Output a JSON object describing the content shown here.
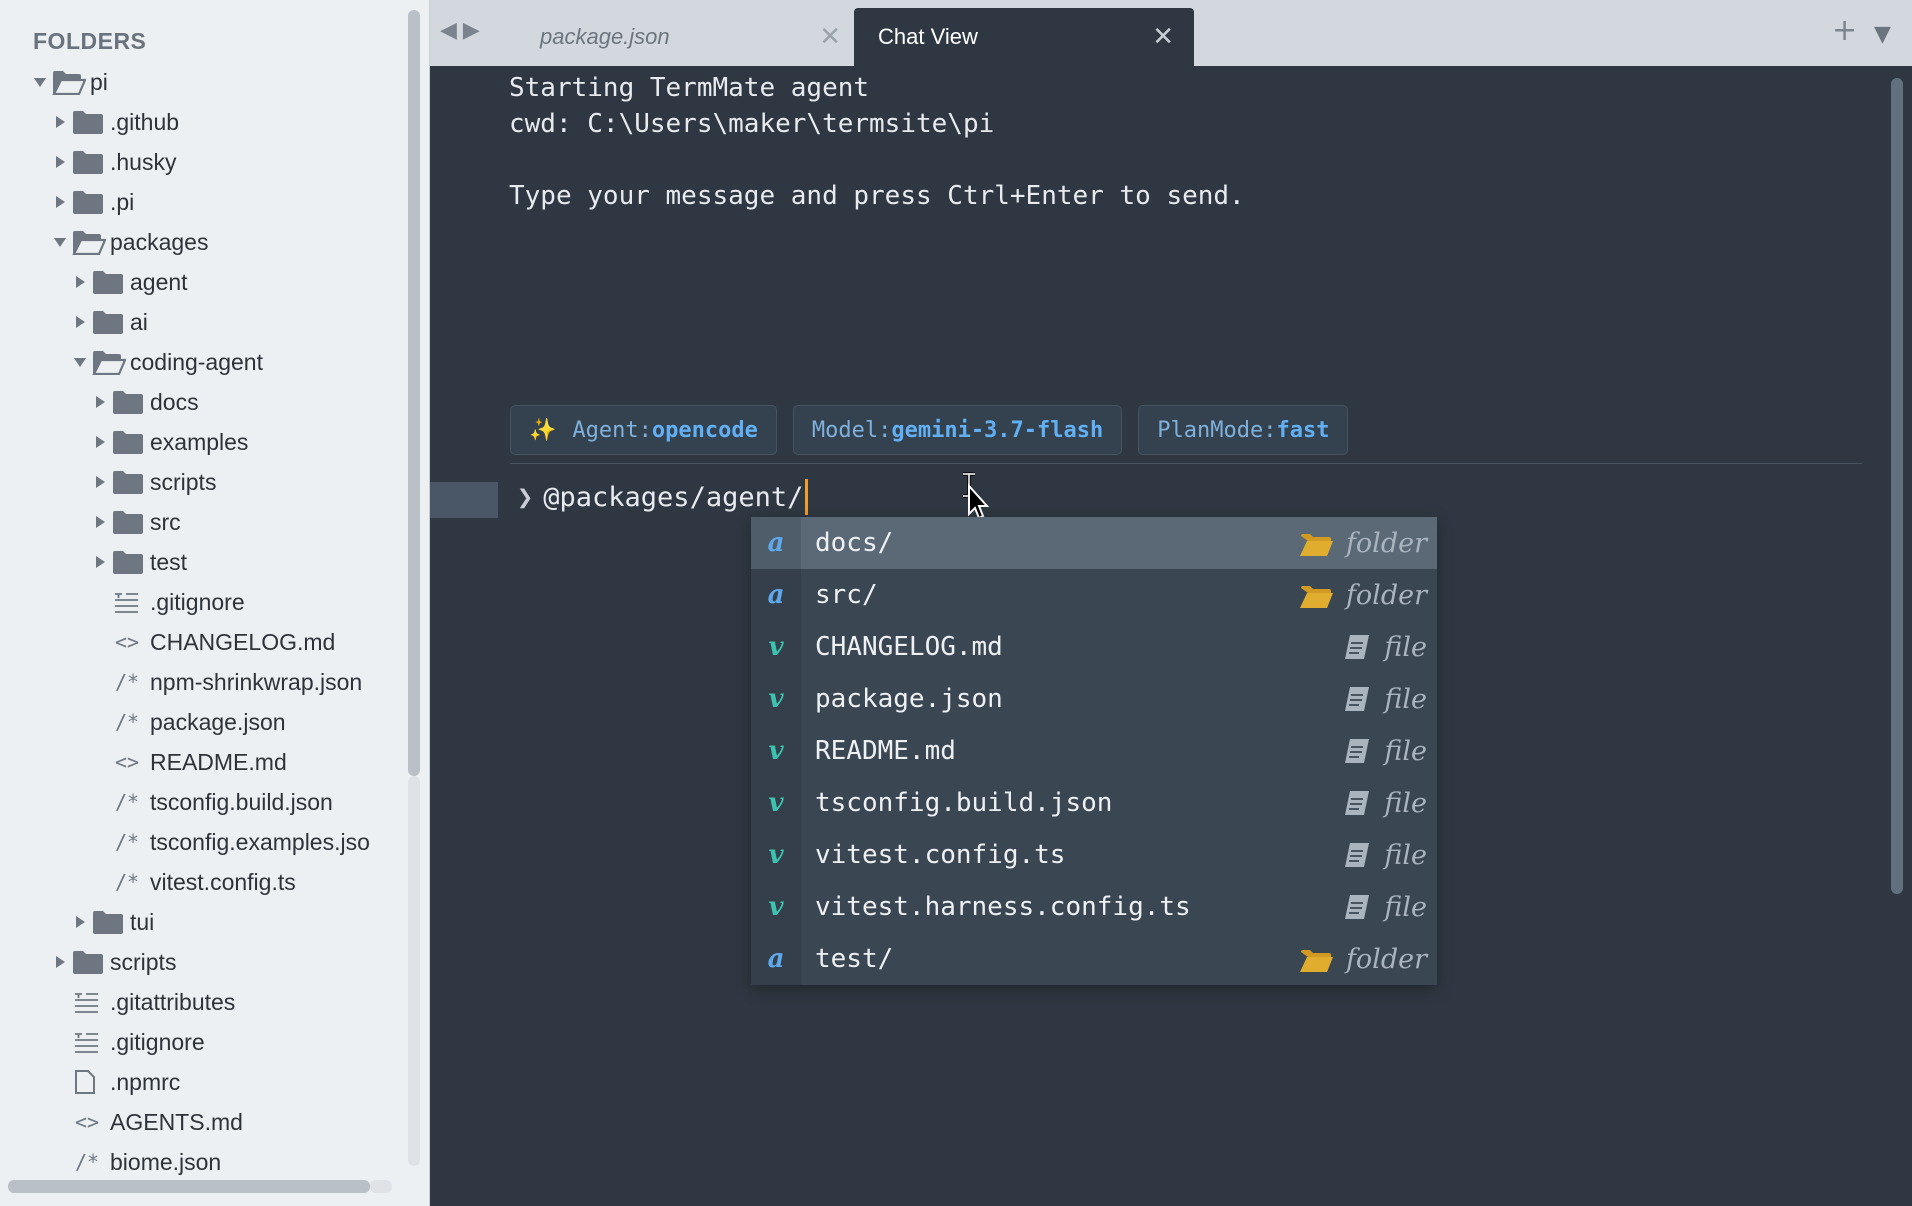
{
  "sidebar": {
    "header": "FOLDERS",
    "items": [
      {
        "label": "pi",
        "type": "folder-open",
        "depth": 0
      },
      {
        "label": ".github",
        "type": "folder",
        "depth": 1
      },
      {
        "label": ".husky",
        "type": "folder",
        "depth": 1
      },
      {
        "label": ".pi",
        "type": "folder",
        "depth": 1
      },
      {
        "label": "packages",
        "type": "folder-open",
        "depth": 1
      },
      {
        "label": "agent",
        "type": "folder",
        "depth": 2
      },
      {
        "label": "ai",
        "type": "folder",
        "depth": 2
      },
      {
        "label": "coding-agent",
        "type": "folder-open",
        "depth": 2
      },
      {
        "label": "docs",
        "type": "folder",
        "depth": 3
      },
      {
        "label": "examples",
        "type": "folder",
        "depth": 3
      },
      {
        "label": "scripts",
        "type": "folder",
        "depth": 3
      },
      {
        "label": "src",
        "type": "folder",
        "depth": 3
      },
      {
        "label": "test",
        "type": "folder",
        "depth": 3
      },
      {
        "label": ".gitignore",
        "type": "file-text",
        "depth": 3
      },
      {
        "label": "CHANGELOG.md",
        "type": "file-code",
        "depth": 3
      },
      {
        "label": "npm-shrinkwrap.json",
        "type": "file-comment",
        "depth": 3
      },
      {
        "label": "package.json",
        "type": "file-comment",
        "depth": 3
      },
      {
        "label": "README.md",
        "type": "file-code",
        "depth": 3
      },
      {
        "label": "tsconfig.build.json",
        "type": "file-comment",
        "depth": 3
      },
      {
        "label": "tsconfig.examples.jso",
        "type": "file-comment",
        "depth": 3
      },
      {
        "label": "vitest.config.ts",
        "type": "file-comment",
        "depth": 3
      },
      {
        "label": "tui",
        "type": "folder",
        "depth": 2
      },
      {
        "label": "scripts",
        "type": "folder",
        "depth": 1
      },
      {
        "label": ".gitattributes",
        "type": "file-text",
        "depth": 1
      },
      {
        "label": ".gitignore",
        "type": "file-text",
        "depth": 1
      },
      {
        "label": ".npmrc",
        "type": "file-blank",
        "depth": 1
      },
      {
        "label": "AGENTS.md",
        "type": "file-code",
        "depth": 1
      },
      {
        "label": "biome.json",
        "type": "file-comment",
        "depth": 1
      }
    ]
  },
  "tabs": {
    "package": {
      "label": "package.json",
      "close": "✕"
    },
    "chat": {
      "label": "Chat View",
      "close": "✕"
    },
    "new_tab": "+",
    "menu": "▼"
  },
  "chat": {
    "lines": [
      "Starting TermMate agent",
      "cwd: C:\\Users\\maker\\termsite\\pi",
      "",
      "Type your message and press Ctrl+Enter to send."
    ],
    "badges": [
      {
        "key": "Agent: ",
        "value": "opencode",
        "icon": "sparkles-icon"
      },
      {
        "key": "Model: ",
        "value": "gemini-3.7-flash"
      },
      {
        "key": "PlanMode: ",
        "value": "fast"
      }
    ],
    "prompt_symbol": "❯",
    "input": "@packages/agent/"
  },
  "autocomplete": {
    "items": [
      {
        "kind": "a",
        "name": "docs/",
        "type": "folder",
        "selected": true
      },
      {
        "kind": "a",
        "name": "src/",
        "type": "folder"
      },
      {
        "kind": "v",
        "name": "CHANGELOG.md",
        "type": "file"
      },
      {
        "kind": "v",
        "name": "package.json",
        "type": "file"
      },
      {
        "kind": "v",
        "name": "README.md",
        "type": "file"
      },
      {
        "kind": "v",
        "name": "tsconfig.build.json",
        "type": "file"
      },
      {
        "kind": "v",
        "name": "vitest.config.ts",
        "type": "file"
      },
      {
        "kind": "v",
        "name": "vitest.harness.config.ts",
        "type": "file"
      },
      {
        "kind": "a",
        "name": "test/",
        "type": "folder"
      }
    ]
  },
  "colors": {
    "folder_icon": "#e0ad2f",
    "accent": "#62b0f3",
    "caret": "#f39c2e"
  }
}
